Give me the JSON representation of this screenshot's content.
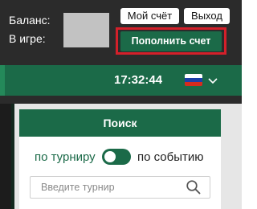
{
  "account": {
    "balance_label": "Баланс:",
    "in_game_label": "В игре:",
    "my_account_label": "Мой счёт",
    "logout_label": "Выход",
    "deposit_label": "Пополнить счет"
  },
  "header": {
    "clock": "17:32:44",
    "language_flag": "russia-flag-icon"
  },
  "search": {
    "title": "Поиск",
    "option_tournament": "по турниру",
    "option_event": "по событию",
    "toggle_state": "tournament",
    "placeholder": "Введите турнир"
  },
  "colors": {
    "brand_green": "#1b6a48",
    "highlight_red": "#d4202a",
    "topbar_bg": "#2b2b2b"
  }
}
